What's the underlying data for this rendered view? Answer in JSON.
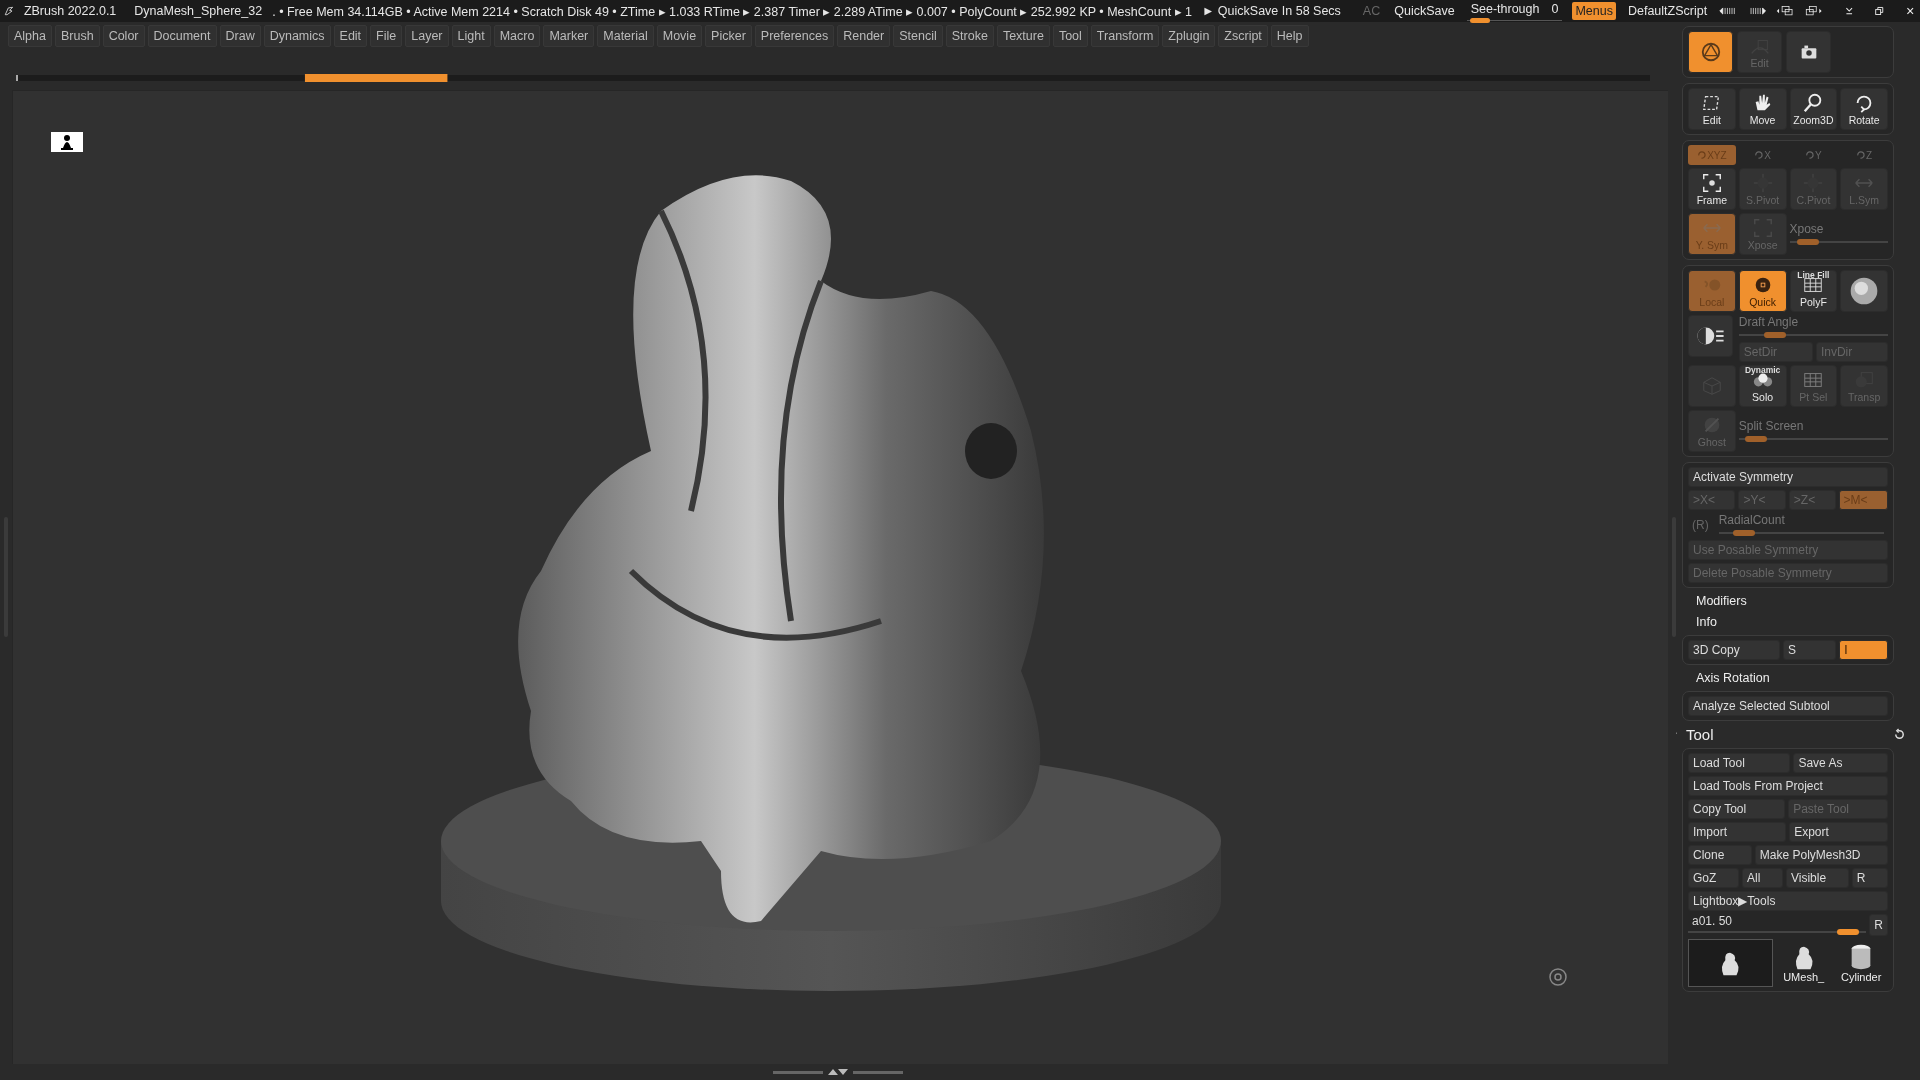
{
  "title_bar": {
    "app": "ZBrush 2022.0.1",
    "document": "DynaMesh_Sphere_32",
    "stats": ". • Free Mem 34.114GB • Active Mem 2214 • Scratch Disk 49 •  ZTime ▸ 1.033 RTime ▸ 2.387 Timer ▸ 2.289 ATime ▸ 0.007 • PolyCount ▸ 252.992 KP  • MeshCount ▸ 1",
    "quicksave_timer": "► QuickSave In 58 Secs",
    "ac_button": {
      "label": "AC",
      "disabled": true
    },
    "quicksave": "QuickSave",
    "see_through": {
      "label": "See-through",
      "value": "0",
      "level": 0.05
    },
    "menus": {
      "label": "Menus",
      "on": true
    },
    "script": "DefaultZScript"
  },
  "menus": [
    "Alpha",
    "Brush",
    "Color",
    "Document",
    "Draw",
    "Dynamics",
    "Edit",
    "File",
    "Layer",
    "Light",
    "Macro",
    "Marker",
    "Material",
    "Movie",
    "Picker",
    "Preferences",
    "Render",
    "Stencil",
    "Stroke",
    "Texture",
    "Tool",
    "Transform",
    "Zplugin",
    "Zscript",
    "Help"
  ],
  "shelf_top": [
    {
      "kind": "material",
      "on": true,
      "disabled": false
    },
    {
      "kind": "edit",
      "label": "Edit",
      "on": false,
      "disabled": true
    },
    {
      "kind": "camera",
      "on": false,
      "disabled": false
    }
  ],
  "nav_buttons": [
    {
      "kind": "edit-frame",
      "label": "Edit"
    },
    {
      "kind": "hand",
      "label": "Move"
    },
    {
      "kind": "magnifier",
      "label": "Zoom3D"
    },
    {
      "kind": "rotate",
      "label": "Rotate"
    }
  ],
  "rotation_axes": [
    {
      "label": "XYZ",
      "selected": true
    },
    {
      "label": "X",
      "selected": false
    },
    {
      "label": "Y",
      "selected": false
    },
    {
      "label": "Z",
      "selected": false
    }
  ],
  "pivot_buttons": [
    {
      "kind": "frame",
      "label": "Frame",
      "disabled": false
    },
    {
      "kind": "crosshair",
      "label": "S.Pivot",
      "disabled": true
    },
    {
      "kind": "crosshair",
      "label": "C.Pivot",
      "disabled": true
    },
    {
      "kind": "arrows",
      "label": "L.Sym",
      "disabled": true
    }
  ],
  "sym_buttons": [
    {
      "kind": "arrows",
      "label": "Y. Sym",
      "on": true,
      "disabled": true
    },
    {
      "kind": "expand",
      "label": "Xpose",
      "on": false,
      "disabled": true
    }
  ],
  "xpose_slider": {
    "label": "Xpose",
    "level": 0.1
  },
  "display_buttons": [
    {
      "kind": "local",
      "label": "Local",
      "on": true,
      "disabled": true
    },
    {
      "kind": "quick",
      "label": "Quick",
      "on": true,
      "disabled": false
    },
    {
      "kind": "grid",
      "label": "PolyF",
      "caption": "Line Fill",
      "on": false,
      "disabled": false
    },
    {
      "kind": "sphere",
      "on": false,
      "disabled": false
    }
  ],
  "draft_angle": {
    "label": "Draft Angle",
    "level": 0.2
  },
  "dir_buttons": [
    {
      "label": "SetDir",
      "disabled": true
    },
    {
      "label": "InvDir",
      "disabled": true
    }
  ],
  "solo_row": [
    {
      "kind": "cube",
      "disabled": true
    },
    {
      "kind": "solo",
      "label": "Solo",
      "caption": "Dynamic",
      "disabled": false
    },
    {
      "kind": "grid",
      "label": "Pt Sel",
      "disabled": true
    },
    {
      "kind": "transp",
      "label": "Transp",
      "disabled": true
    }
  ],
  "ghost_button": {
    "label": "Ghost",
    "disabled": true
  },
  "split_screen": {
    "label": "Split Screen",
    "level": 0.05
  },
  "symmetry": {
    "title": "Activate Symmetry",
    "axes": [
      {
        "label": ">X<",
        "on": false
      },
      {
        "label": ">Y<",
        "on": false
      },
      {
        "label": ">Z<",
        "on": false
      },
      {
        "label": ">M<",
        "on": true
      }
    ],
    "radial_toggle": "(R)",
    "radial_count": {
      "label": "RadialCount",
      "level": 0.1
    },
    "buttons": [
      {
        "label": "Use Posable Symmetry",
        "disabled": true
      },
      {
        "label": "Delete Posable Symmetry",
        "disabled": true
      }
    ]
  },
  "subpalettes_a": [
    "Modifiers",
    "Info"
  ],
  "copy_row": [
    {
      "label": "3D Copy",
      "on": false
    },
    {
      "label": "S",
      "on": false
    },
    {
      "label": "I",
      "on": true
    }
  ],
  "subpalettes_b": [
    "Axis Rotation"
  ],
  "analyze_button": "Analyze Selected Subtool",
  "tool_palette": {
    "title": "Tool",
    "rows": [
      [
        {
          "label": "Load Tool",
          "disabled": false
        },
        {
          "label": "Save As",
          "disabled": false
        }
      ],
      [
        {
          "label": "Load Tools From Project",
          "disabled": false
        }
      ],
      [
        {
          "label": "Copy Tool",
          "disabled": false
        },
        {
          "label": "Paste Tool",
          "disabled": true
        }
      ],
      [
        {
          "label": "Import",
          "disabled": false
        },
        {
          "label": "Export",
          "disabled": false
        }
      ],
      [
        {
          "label": "Clone",
          "disabled": false
        },
        {
          "label": "Make PolyMesh3D",
          "disabled": false
        }
      ],
      [
        {
          "label": "GoZ",
          "disabled": false
        },
        {
          "label": "All",
          "disabled": false
        },
        {
          "label": "Visible",
          "disabled": false
        },
        {
          "label": "R",
          "disabled": false
        }
      ],
      [
        {
          "label": "Lightbox▶Tools",
          "disabled": false
        }
      ]
    ],
    "tool_slider": {
      "label": "a01. 50",
      "level": 0.95,
      "reset": "R"
    },
    "thumbnails": [
      {
        "kind": "sculpt",
        "selected": true
      },
      {
        "kind": "sculpt",
        "label": "UMesh_",
        "selected": false
      },
      {
        "kind": "cylinder",
        "label": "Cylinder",
        "selected": false
      }
    ]
  }
}
